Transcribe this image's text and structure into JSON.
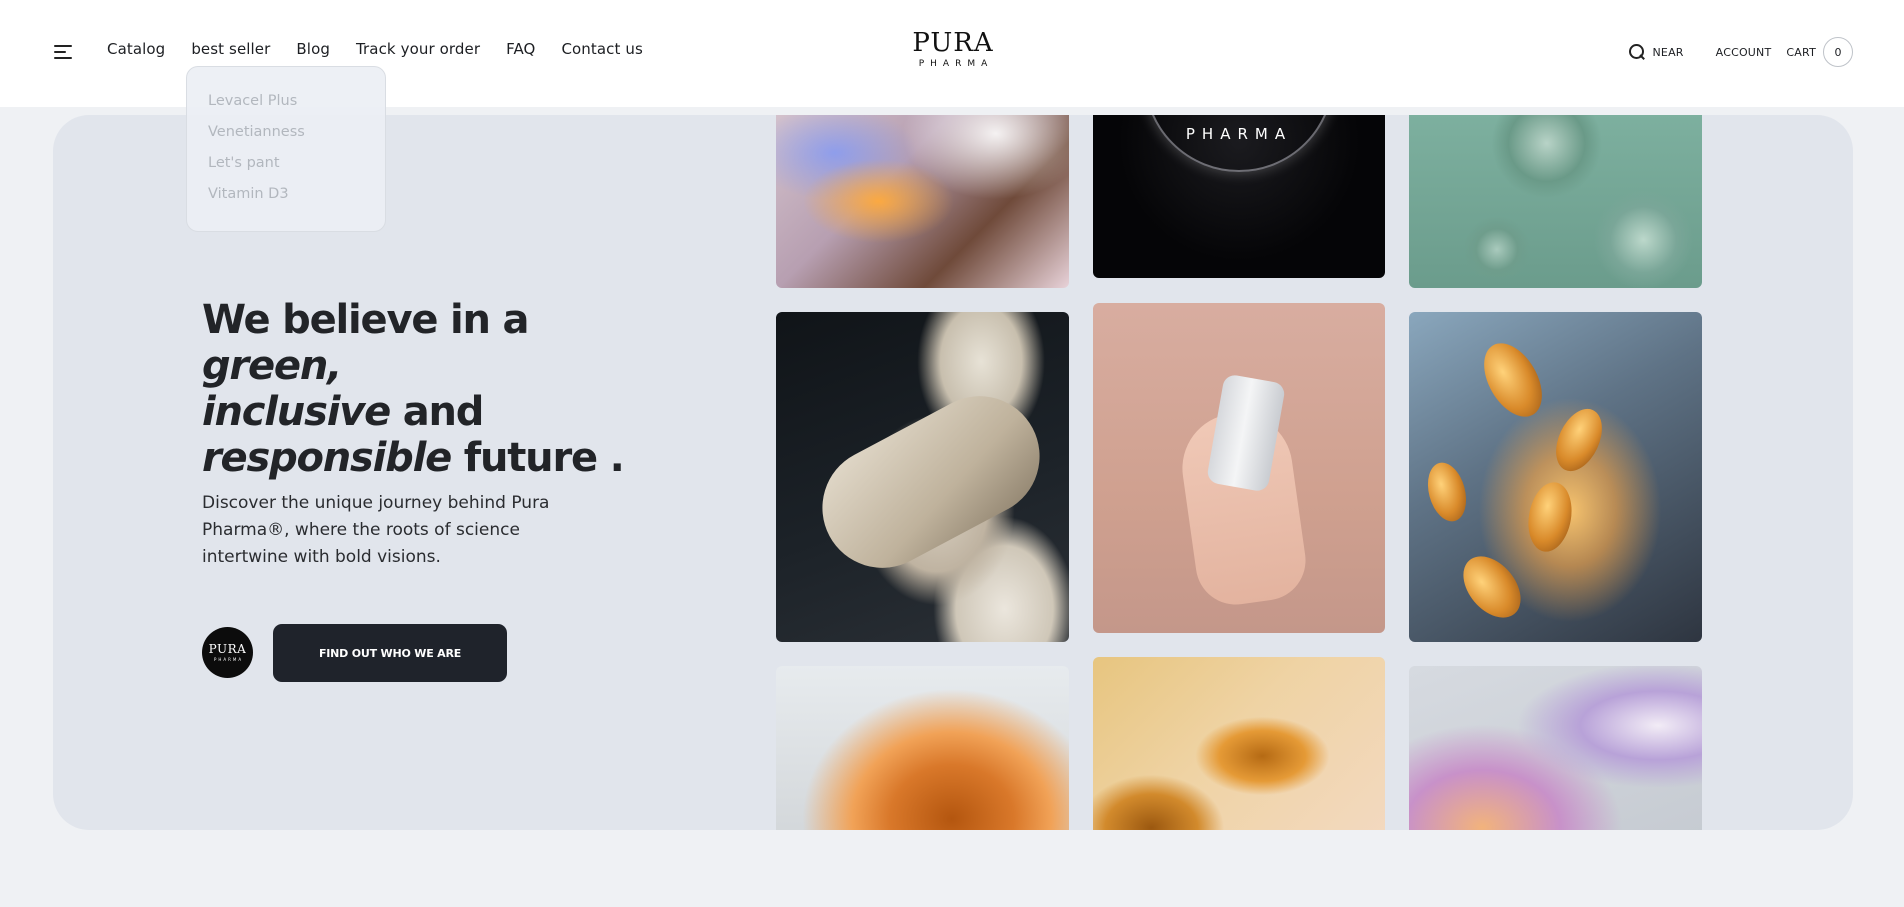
{
  "header": {
    "nav": [
      "Catalog",
      "best seller",
      "Blog",
      "Track your order",
      "FAQ",
      "Contact us"
    ],
    "logo": {
      "main": "PURA",
      "sub": "PHARMA"
    },
    "search_label": "NEAR",
    "account_label": "ACCOUNT",
    "cart_label": "CART",
    "cart_count": "0"
  },
  "dropdown": {
    "items": [
      "Levacel Plus",
      "Venetianness",
      "Let's pant",
      "Vitamin D3"
    ]
  },
  "hero": {
    "headline": {
      "part1": "We believe in a ",
      "em1": "green,",
      "em2": "inclusive",
      "part2": " and",
      "em3": "responsible",
      "part3": " future ."
    },
    "body": "Discover the unique journey behind Pura Pharma®, where the roots of science intertwine with bold visions.",
    "badge": {
      "main": "PURA",
      "sub": "PHARMA"
    },
    "cta": "FIND OUT WHO WE ARE",
    "tile_brand": "PHARMA"
  },
  "colors": {
    "page_bg": "#eff1f4",
    "hero_bg": "#e1e5ec",
    "cta_bg": "#1f232b",
    "text": "#222428"
  },
  "icons": [
    "hamburger-menu-icon",
    "search-icon"
  ]
}
